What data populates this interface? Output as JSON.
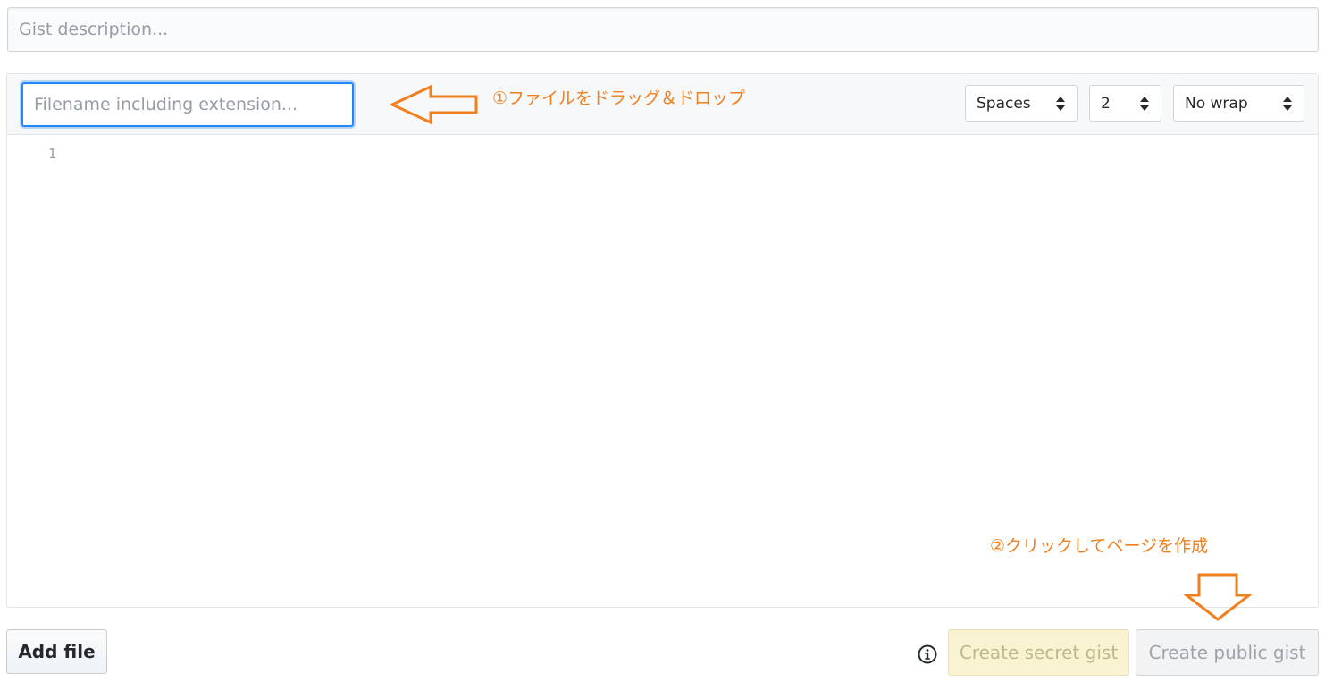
{
  "description": {
    "placeholder": "Gist description..."
  },
  "file": {
    "filename_placeholder": "Filename including extension...",
    "indent_mode": "Spaces",
    "indent_size": "2",
    "wrap_mode": "No wrap",
    "line_number": "1"
  },
  "annotations": {
    "step1": "①ファイルをドラッグ＆ドロップ",
    "step2": "②クリックしてページを作成"
  },
  "actions": {
    "add_file": "Add file",
    "create_secret": "Create secret gist",
    "create_public": "Create public gist"
  },
  "colors": {
    "annotation": "#f07f1e",
    "focus": "#2188ff"
  },
  "icons": {
    "info": "info-icon",
    "caret": "caret-up-down-icon"
  }
}
